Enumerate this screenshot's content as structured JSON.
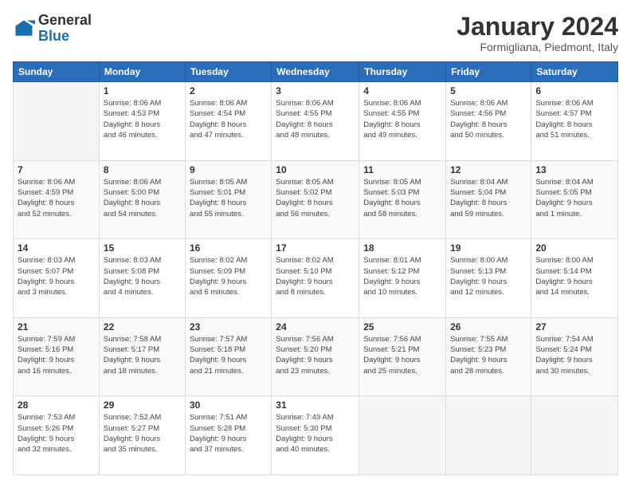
{
  "header": {
    "logo": {
      "general": "General",
      "blue": "Blue"
    },
    "title": "January 2024",
    "location": "Formigliana, Piedmont, Italy"
  },
  "calendar": {
    "headers": [
      "Sunday",
      "Monday",
      "Tuesday",
      "Wednesday",
      "Thursday",
      "Friday",
      "Saturday"
    ],
    "weeks": [
      [
        {
          "day": "",
          "info": ""
        },
        {
          "day": "1",
          "info": "Sunrise: 8:06 AM\nSunset: 4:53 PM\nDaylight: 8 hours\nand 46 minutes."
        },
        {
          "day": "2",
          "info": "Sunrise: 8:06 AM\nSunset: 4:54 PM\nDaylight: 8 hours\nand 47 minutes."
        },
        {
          "day": "3",
          "info": "Sunrise: 8:06 AM\nSunset: 4:55 PM\nDaylight: 8 hours\nand 48 minutes."
        },
        {
          "day": "4",
          "info": "Sunrise: 8:06 AM\nSunset: 4:55 PM\nDaylight: 8 hours\nand 49 minutes."
        },
        {
          "day": "5",
          "info": "Sunrise: 8:06 AM\nSunset: 4:56 PM\nDaylight: 8 hours\nand 50 minutes."
        },
        {
          "day": "6",
          "info": "Sunrise: 8:06 AM\nSunset: 4:57 PM\nDaylight: 8 hours\nand 51 minutes."
        }
      ],
      [
        {
          "day": "7",
          "info": "Sunrise: 8:06 AM\nSunset: 4:59 PM\nDaylight: 8 hours\nand 52 minutes."
        },
        {
          "day": "8",
          "info": "Sunrise: 8:06 AM\nSunset: 5:00 PM\nDaylight: 8 hours\nand 54 minutes."
        },
        {
          "day": "9",
          "info": "Sunrise: 8:05 AM\nSunset: 5:01 PM\nDaylight: 8 hours\nand 55 minutes."
        },
        {
          "day": "10",
          "info": "Sunrise: 8:05 AM\nSunset: 5:02 PM\nDaylight: 8 hours\nand 56 minutes."
        },
        {
          "day": "11",
          "info": "Sunrise: 8:05 AM\nSunset: 5:03 PM\nDaylight: 8 hours\nand 58 minutes."
        },
        {
          "day": "12",
          "info": "Sunrise: 8:04 AM\nSunset: 5:04 PM\nDaylight: 8 hours\nand 59 minutes."
        },
        {
          "day": "13",
          "info": "Sunrise: 8:04 AM\nSunset: 5:05 PM\nDaylight: 9 hours\nand 1 minute."
        }
      ],
      [
        {
          "day": "14",
          "info": "Sunrise: 8:03 AM\nSunset: 5:07 PM\nDaylight: 9 hours\nand 3 minutes."
        },
        {
          "day": "15",
          "info": "Sunrise: 8:03 AM\nSunset: 5:08 PM\nDaylight: 9 hours\nand 4 minutes."
        },
        {
          "day": "16",
          "info": "Sunrise: 8:02 AM\nSunset: 5:09 PM\nDaylight: 9 hours\nand 6 minutes."
        },
        {
          "day": "17",
          "info": "Sunrise: 8:02 AM\nSunset: 5:10 PM\nDaylight: 9 hours\nand 8 minutes."
        },
        {
          "day": "18",
          "info": "Sunrise: 8:01 AM\nSunset: 5:12 PM\nDaylight: 9 hours\nand 10 minutes."
        },
        {
          "day": "19",
          "info": "Sunrise: 8:00 AM\nSunset: 5:13 PM\nDaylight: 9 hours\nand 12 minutes."
        },
        {
          "day": "20",
          "info": "Sunrise: 8:00 AM\nSunset: 5:14 PM\nDaylight: 9 hours\nand 14 minutes."
        }
      ],
      [
        {
          "day": "21",
          "info": "Sunrise: 7:59 AM\nSunset: 5:16 PM\nDaylight: 9 hours\nand 16 minutes."
        },
        {
          "day": "22",
          "info": "Sunrise: 7:58 AM\nSunset: 5:17 PM\nDaylight: 9 hours\nand 18 minutes."
        },
        {
          "day": "23",
          "info": "Sunrise: 7:57 AM\nSunset: 5:18 PM\nDaylight: 9 hours\nand 21 minutes."
        },
        {
          "day": "24",
          "info": "Sunrise: 7:56 AM\nSunset: 5:20 PM\nDaylight: 9 hours\nand 23 minutes."
        },
        {
          "day": "25",
          "info": "Sunrise: 7:56 AM\nSunset: 5:21 PM\nDaylight: 9 hours\nand 25 minutes."
        },
        {
          "day": "26",
          "info": "Sunrise: 7:55 AM\nSunset: 5:23 PM\nDaylight: 9 hours\nand 28 minutes."
        },
        {
          "day": "27",
          "info": "Sunrise: 7:54 AM\nSunset: 5:24 PM\nDaylight: 9 hours\nand 30 minutes."
        }
      ],
      [
        {
          "day": "28",
          "info": "Sunrise: 7:53 AM\nSunset: 5:26 PM\nDaylight: 9 hours\nand 32 minutes."
        },
        {
          "day": "29",
          "info": "Sunrise: 7:52 AM\nSunset: 5:27 PM\nDaylight: 9 hours\nand 35 minutes."
        },
        {
          "day": "30",
          "info": "Sunrise: 7:51 AM\nSunset: 5:28 PM\nDaylight: 9 hours\nand 37 minutes."
        },
        {
          "day": "31",
          "info": "Sunrise: 7:49 AM\nSunset: 5:30 PM\nDaylight: 9 hours\nand 40 minutes."
        },
        {
          "day": "",
          "info": ""
        },
        {
          "day": "",
          "info": ""
        },
        {
          "day": "",
          "info": ""
        }
      ]
    ]
  }
}
